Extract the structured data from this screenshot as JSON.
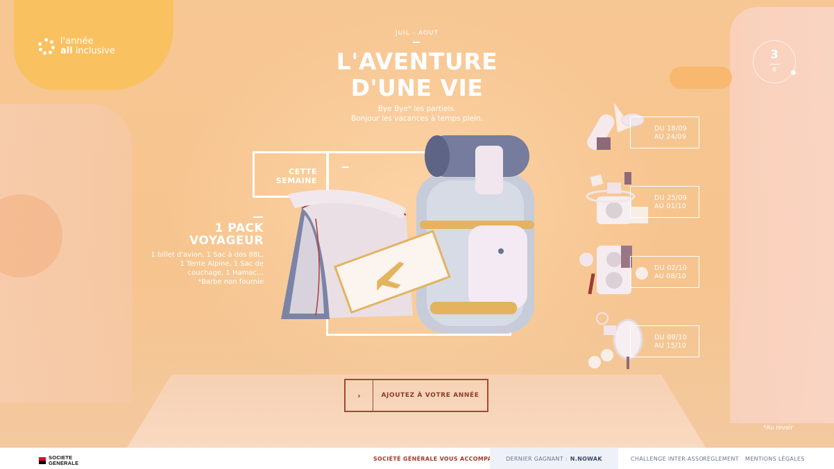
{
  "brand": {
    "line1": "l'année",
    "line2_bold": "all",
    "line2_rest": " inclusive"
  },
  "counter": {
    "current": "3",
    "total": "6"
  },
  "hero": {
    "period": "JUIL - AOUT",
    "title_line1": "L'AVENTURE",
    "title_line2": "D'UNE VIE",
    "subtitle_line1": "Bye Bye* les partiels.",
    "subtitle_line2": "Bonjour les vacances à temps plein."
  },
  "this_week": {
    "label_line1": "CETTE",
    "label_line2": "SEMAINE"
  },
  "pack": {
    "title_line1": "1 PACK",
    "title_line2": "VOYAGEUR",
    "desc_line1": "1 billet d'avion, 1 Sac à dos 88L,",
    "desc_line2": "1 Tente Alpine, 1 Sac de",
    "desc_line3": "couchage, 1 Hamac…",
    "desc_line4": "*Barbe non fournie"
  },
  "weeks": [
    {
      "line1": "DU 18/09",
      "line2": "AU 24/09",
      "icon": "surf-snorkel-icon"
    },
    {
      "line1": "DU 25/09",
      "line2": "AU 01/10",
      "icon": "camera-photos-icon"
    },
    {
      "line1": "DU 02/10",
      "line2": "AU 08/10",
      "icon": "speaker-music-icon"
    },
    {
      "line1": "DU 09/10",
      "line2": "AU 15/10",
      "icon": "mirror-badminton-icon"
    }
  ],
  "cta": {
    "arrow": "›",
    "label": "AJOUTEZ À VOTRE ANNÉE"
  },
  "footnote": "*Au revoir",
  "footer": {
    "sg_line1": "SOCIETE",
    "sg_line2": "GENERALE",
    "accompagne": "SOCIÉTÉ GÉNÉRALE VOUS ACCOMPAGNE",
    "winner_label": "DERNIER GAGNANT :",
    "winner_name": "N.NOWAK",
    "link_challenge": "CHALLENGE INTER-ASSO",
    "link_reglement": "RÈGLEMENT",
    "link_mentions": "MENTIONS LÉGALES"
  },
  "colors": {
    "background": "#f6c690",
    "cta_border": "#a5482a",
    "footer_accent": "#a23b2a",
    "sg_red": "#e60028"
  }
}
